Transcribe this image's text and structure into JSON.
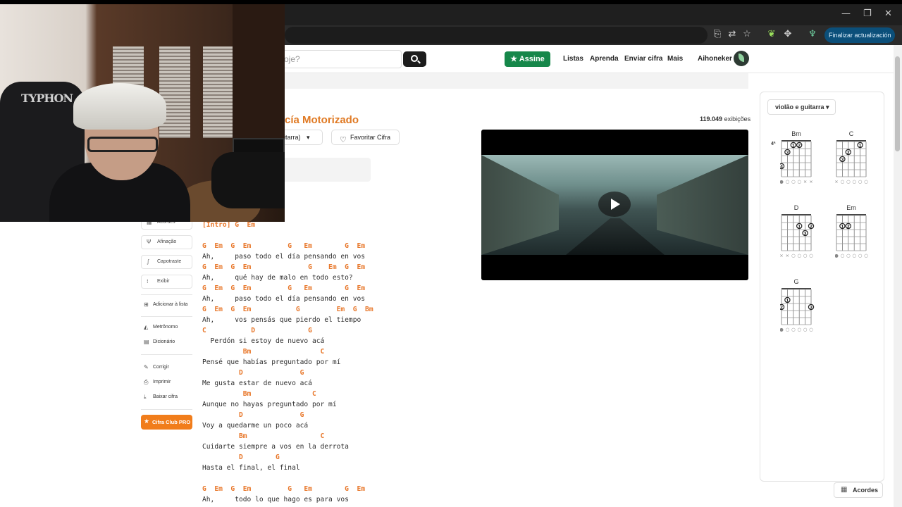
{
  "browser": {
    "update_label": "Finalizar actualización",
    "minimize": "—",
    "restore": "❐",
    "close": "✕"
  },
  "header": {
    "search_placeholder": "oje?",
    "assine_label": "Assine",
    "nav": [
      "Listas",
      "Aprenda",
      "Enviar cifra",
      "Mais"
    ],
    "username": "Aihoneker"
  },
  "song": {
    "title_fragment": "cía Motorizado",
    "views_number": "119.049",
    "views_label": "exibições",
    "instrument_fragment": "uitarra)",
    "favorite_label": "Favoritar Cifra"
  },
  "sidebar": {
    "tools": [
      "Acordes",
      "Afinação",
      "Capotraste",
      "Exibir"
    ],
    "links_a": [
      "Adicionar à lista"
    ],
    "links_b": [
      "Metrônomo",
      "Dicionário"
    ],
    "links_c": [
      "Corrigir",
      "Imprimir",
      "Baixar cifra"
    ],
    "pro_label": "Cifra Club PRO"
  },
  "lyrics": [
    {
      "t": "ch",
      "s": "[Intro] G  Em"
    },
    {
      "t": "gap",
      "s": ""
    },
    {
      "t": "ch",
      "s": "G  Em  G  Em         G   Em        G  Em"
    },
    {
      "t": "ly",
      "s": "Ah,     paso todo el día pensando en vos"
    },
    {
      "t": "ch",
      "s": "G  Em  G  Em              G    Em  G  Em"
    },
    {
      "t": "ly",
      "s": "Ah,     qué hay de malo en todo esto?"
    },
    {
      "t": "ch",
      "s": "G  Em  G  Em         G   Em        G  Em"
    },
    {
      "t": "ly",
      "s": "Ah,     paso todo el día pensando en vos"
    },
    {
      "t": "ch",
      "s": "G  Em  G  Em           G         Em  G  Bm"
    },
    {
      "t": "ly",
      "s": "Ah,     vos pensás que pierdo el tiempo"
    },
    {
      "t": "ch",
      "s": "C           D             G"
    },
    {
      "t": "ly",
      "s": "  Perdón si estoy de nuevo acá"
    },
    {
      "t": "ch",
      "s": "          Bm                 C"
    },
    {
      "t": "ly",
      "s": "Pensé que habías preguntado por mí"
    },
    {
      "t": "ch",
      "s": "         D              G"
    },
    {
      "t": "ly",
      "s": "Me gusta estar de nuevo acá"
    },
    {
      "t": "ch",
      "s": "          Bm               C"
    },
    {
      "t": "ly",
      "s": "Aunque no hayas preguntado por mí"
    },
    {
      "t": "ch",
      "s": "         D              G"
    },
    {
      "t": "ly",
      "s": "Voy a quedarme un poco acá"
    },
    {
      "t": "ch",
      "s": "         Bm                  C"
    },
    {
      "t": "ly",
      "s": "Cuidarte siempre a vos en la derrota"
    },
    {
      "t": "ch",
      "s": "         D        G"
    },
    {
      "t": "ly",
      "s": "Hasta el final, el final"
    },
    {
      "t": "gap",
      "s": ""
    },
    {
      "t": "ch",
      "s": "G  Em  G  Em         G   Em        G  Em"
    },
    {
      "t": "ly",
      "s": "Ah,     todo lo que hago es para vos"
    }
  ],
  "chords_panel": {
    "instrument_select": "violão e guitarra",
    "chords": [
      {
        "name": "Bm",
        "fret_label": "4ª",
        "col": 0,
        "row": 0,
        "dots": [
          [
            2,
            1,
            "1"
          ],
          [
            3,
            1,
            "2"
          ],
          [
            1,
            2,
            "3"
          ],
          [
            0,
            4,
            "4"
          ]
        ],
        "open": [
          "o",
          "o",
          "o",
          "o",
          "x",
          "x"
        ]
      },
      {
        "name": "C",
        "fret_label": "",
        "col": 1,
        "row": 0,
        "dots": [
          [
            4,
            1,
            "1"
          ],
          [
            2,
            2,
            "2"
          ],
          [
            1,
            3,
            "3"
          ]
        ],
        "open": [
          "x",
          "o",
          "o",
          "o",
          "o",
          "o"
        ]
      },
      {
        "name": "D",
        "fret_label": "",
        "col": 0,
        "row": 1,
        "dots": [
          [
            3,
            2,
            "1"
          ],
          [
            5,
            2,
            "2"
          ],
          [
            4,
            3,
            "3"
          ]
        ],
        "open": [
          "x",
          "x",
          "o",
          "o",
          "o",
          "o"
        ]
      },
      {
        "name": "Em",
        "fret_label": "",
        "col": 1,
        "row": 1,
        "dots": [
          [
            1,
            2,
            "1"
          ],
          [
            2,
            2,
            "2"
          ]
        ],
        "open": [
          "o",
          "o",
          "o",
          "o",
          "o",
          "o"
        ]
      },
      {
        "name": "G",
        "fret_label": "",
        "col": 0,
        "row": 2,
        "dots": [
          [
            1,
            2,
            "1"
          ],
          [
            0,
            3,
            "2"
          ],
          [
            5,
            3,
            "3"
          ]
        ],
        "open": [
          "o",
          "o",
          "o",
          "o",
          "o",
          "o"
        ]
      }
    ],
    "acordes_label": "Acordes"
  },
  "colors": {
    "accent_orange": "#e07a24",
    "assine_green": "#16874a",
    "chord_text": "#e8772a"
  }
}
